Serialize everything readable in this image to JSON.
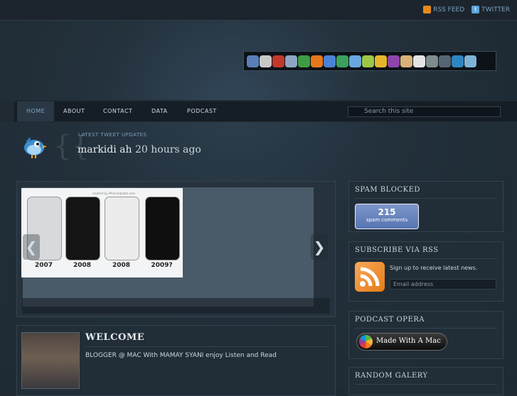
{
  "top_links": {
    "rss": "RSS FEED",
    "twitter": "TWITTER"
  },
  "nav": {
    "items": [
      "HOME",
      "ABOUT",
      "CONTACT",
      "DATA",
      "PODCAST"
    ],
    "active": "HOME"
  },
  "search": {
    "placeholder": "Search this site"
  },
  "tweet": {
    "label": "LATEST TWEET UPDATES",
    "user": "markidi ah",
    "time": "20 hours ago"
  },
  "slider": {
    "photo_caption": "created by iPhoneUpdate.com",
    "phones": [
      {
        "year": "2007",
        "color": "#d8d9db"
      },
      {
        "year": "2008",
        "color": "#141414"
      },
      {
        "year": "2008",
        "color": "#ececec"
      },
      {
        "year": "2009?",
        "color": "#0f0f0f"
      }
    ],
    "prev_glyph": "❮",
    "next_glyph": "❯"
  },
  "welcome": {
    "title": "WELCOME",
    "text": "BLOGGER @ MAC With  MAMAY SYANI enjoy Listen and Read"
  },
  "sidebar": {
    "spam": {
      "title": "SPAM BLOCKED",
      "count": "215",
      "label": "spam comments"
    },
    "rss": {
      "title": "SUBSCRIBE VIA RSS",
      "text": "Sign up to receive latest news.",
      "placeholder": "Email address"
    },
    "podcast": {
      "title": "PODCAST OPERA",
      "badge": "Made With A Mac"
    },
    "gallery": {
      "title": "RANDOM GALERY"
    }
  },
  "dock_icon_colors": [
    "#5a7fb6",
    "#c8c8c8",
    "#c0392b",
    "#8ea6c4",
    "#3f9b45",
    "#e8771c",
    "#4a82d6",
    "#3aa05c",
    "#6aa7e0",
    "#9cc747",
    "#e7b62c",
    "#8e44ad",
    "#d8b27a",
    "#e4e4e4",
    "#7f8c8d",
    "#566573",
    "#2e86c1",
    "#7fb3d5"
  ],
  "colors": {
    "accent": "#7aa7c7",
    "background": "#1f2a33"
  }
}
